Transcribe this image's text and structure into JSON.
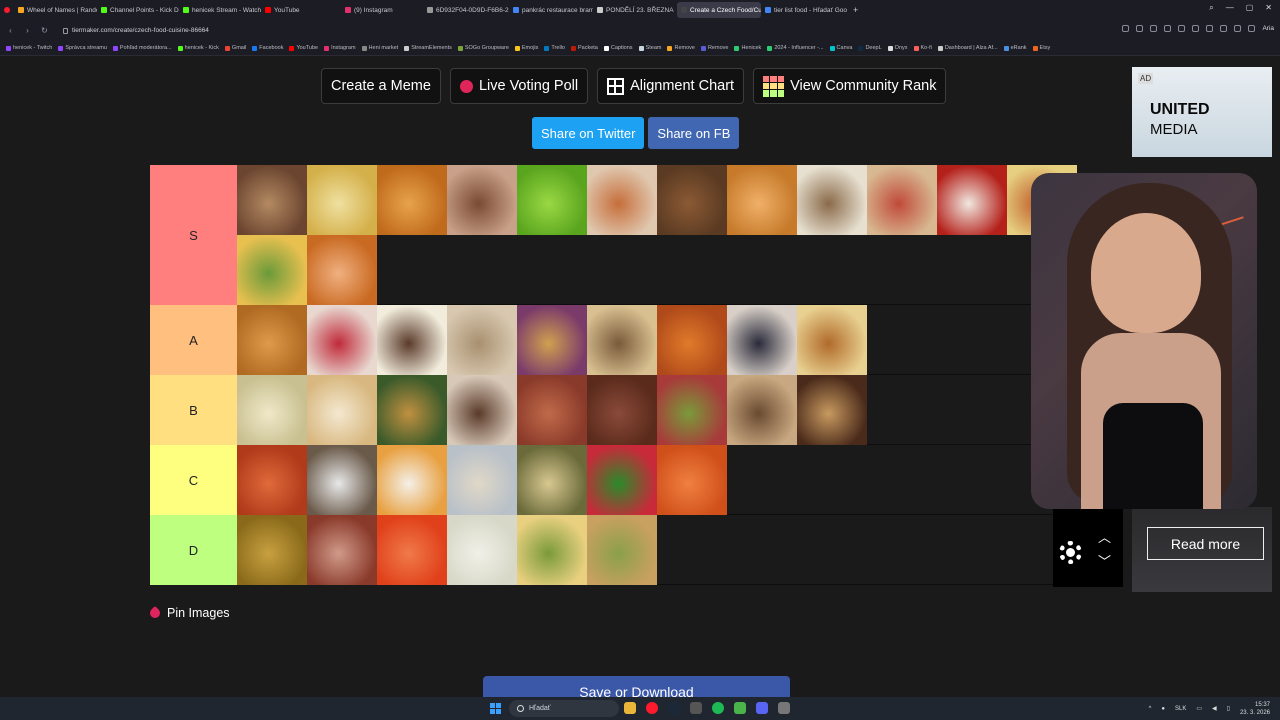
{
  "browser": {
    "tabs": [
      {
        "label": "Wheel of Names | Rando",
        "color": "#f5a623",
        "active": false
      },
      {
        "label": "Channel Points - Kick Dc",
        "color": "#53fc18",
        "active": false
      },
      {
        "label": "henicek Stream - Watch L",
        "color": "#53fc18",
        "active": false
      },
      {
        "label": "YouTube",
        "color": "#ff0000",
        "active": false
      },
      {
        "label": "(9) Instagram",
        "color": "#e1306c",
        "active": false
      },
      {
        "label": "6D932F04-0D9D-F6B6-2C",
        "color": "#999999",
        "active": false
      },
      {
        "label": "pankrác restaurace brambo",
        "color": "#4285f4",
        "active": false
      },
      {
        "label": "PONDĚLÍ 23. BŘEZNA",
        "color": "#cccccc",
        "active": false
      },
      {
        "label": "Create a Czech Food/Cuis",
        "color": "#444444",
        "active": true
      },
      {
        "label": "tier list food - Hľadať Goo",
        "color": "#4285f4",
        "active": false
      }
    ],
    "new_tab": "+",
    "url": "tiermaker.com/create/czech-food-cuisine-86664",
    "ai_label": "Aria",
    "bookmarks": [
      {
        "label": "henicek - Twitch",
        "color": "#9146ff"
      },
      {
        "label": "Správca streamu",
        "color": "#9146ff"
      },
      {
        "label": "Pohľad moderátora...",
        "color": "#9146ff"
      },
      {
        "label": "henicek - Kick",
        "color": "#53fc18"
      },
      {
        "label": "Gmail",
        "color": "#ea4335"
      },
      {
        "label": "Facebook",
        "color": "#1877f2"
      },
      {
        "label": "YouTube",
        "color": "#ff0000"
      },
      {
        "label": "Instagram",
        "color": "#e1306c"
      },
      {
        "label": "Heni market",
        "color": "#888888"
      },
      {
        "label": "StreamElements",
        "color": "#cccccc"
      },
      {
        "label": "SOGo Groupware",
        "color": "#7aa33a"
      },
      {
        "label": "Emojis",
        "color": "#f5c518"
      },
      {
        "label": "Trello",
        "color": "#0079bf"
      },
      {
        "label": "Packeta",
        "color": "#ba1b02"
      },
      {
        "label": "Captions",
        "color": "#ffffff"
      },
      {
        "label": "Steam",
        "color": "#c7d5e0"
      },
      {
        "label": "Remove",
        "color": "#f5a623"
      },
      {
        "label": "Remove",
        "color": "#5b5bd6"
      },
      {
        "label": "Henicek",
        "color": "#2ecc71"
      },
      {
        "label": "2024 - Influencer -...",
        "color": "#2ecc71"
      },
      {
        "label": "Canva",
        "color": "#00c4cc"
      },
      {
        "label": "DeepL",
        "color": "#0f2b46"
      },
      {
        "label": "Onyx",
        "color": "#dddddd"
      },
      {
        "label": "Ko-fi",
        "color": "#ff5e5b"
      },
      {
        "label": "Dashboard | Alza Af...",
        "color": "#cccccc"
      },
      {
        "label": "eRank",
        "color": "#4a90e2"
      },
      {
        "label": "Etsy",
        "color": "#f1641e"
      }
    ]
  },
  "toolbar": {
    "create_meme": "Create a Meme",
    "live_poll": "Live Voting Poll",
    "alignment_chart": "Alignment Chart",
    "community_rank": "View Community Rank",
    "share_twitter": "Share on Twitter",
    "share_fb": "Share on FB"
  },
  "tiers": [
    {
      "label": "S",
      "color": "#ff7f7f",
      "items": [
        [
          "#6b4530",
          "#b48a62"
        ],
        [
          "#d4b04a",
          "#efe0a0"
        ],
        [
          "#c06a1c",
          "#e7a34a"
        ],
        [
          "#c9a089",
          "#7a4a32"
        ],
        [
          "#5aa51e",
          "#9ad844"
        ],
        [
          "#e0c8b0",
          "#c66e3a"
        ],
        [
          "#5a3a22",
          "#8b5a34"
        ],
        [
          "#c67a2a",
          "#f0b068"
        ],
        [
          "#e7e0d0",
          "#8a6a4a"
        ],
        [
          "#d8b890",
          "#c04a3a"
        ],
        [
          "#b4201a",
          "#f0e8e0"
        ],
        [
          "#e6d080",
          "#c05a2a"
        ],
        [
          "#e8c050",
          "#6a9a3a"
        ],
        [
          "#c96a22",
          "#f0b080"
        ]
      ]
    },
    {
      "label": "A",
      "color": "#ffbf7f",
      "items": [
        [
          "#b06a22",
          "#e09a4a"
        ],
        [
          "#e8d8d0",
          "#c02a3a"
        ],
        [
          "#f2ecdc",
          "#5a3a2a"
        ],
        [
          "#d8c8b0",
          "#a89070"
        ],
        [
          "#7a3a6a",
          "#d0a050"
        ],
        [
          "#d8c090",
          "#7a5a3a"
        ],
        [
          "#b04a1a",
          "#e07a2a"
        ],
        [
          "#d8d0c8",
          "#2a2a3a"
        ],
        [
          "#e8d090",
          "#b06a2a"
        ]
      ]
    },
    {
      "label": "B",
      "color": "#ffdf7f",
      "items": [
        [
          "#c8c090",
          "#f0e8c8"
        ],
        [
          "#d8b880",
          "#f4e8d0"
        ],
        [
          "#3a5a2a",
          "#c09040"
        ],
        [
          "#d8c8b8",
          "#5a3a2a"
        ],
        [
          "#8a3a2a",
          "#c06a4a"
        ],
        [
          "#5a2a1a",
          "#8a4a3a"
        ],
        [
          "#a83a3a",
          "#7a9a3a"
        ],
        [
          "#c8a880",
          "#6a4a30"
        ],
        [
          "#4a2a1a",
          "#c89a60"
        ]
      ]
    },
    {
      "label": "C",
      "color": "#ffff7f",
      "items": [
        [
          "#b03a1a",
          "#e06a3a"
        ],
        [
          "#6a5a4a",
          "#e8e8e8"
        ],
        [
          "#e8a040",
          "#f4f0e8"
        ],
        [
          "#b8c0c8",
          "#e0d8c8"
        ],
        [
          "#6a6a3a",
          "#d8c890"
        ],
        [
          "#c82a3a",
          "#2a8a2a"
        ],
        [
          "#d0501a",
          "#f08040"
        ]
      ]
    },
    {
      "label": "D",
      "color": "#bfff7f",
      "items": [
        [
          "#8a6a1a",
          "#c8a040"
        ],
        [
          "#8a3a2a",
          "#d09a8a"
        ],
        [
          "#e0401a",
          "#f07a4a"
        ],
        [
          "#d8d8c8",
          "#f0f0e8"
        ],
        [
          "#e8d080",
          "#7a9a3a"
        ],
        [
          "#c8a060",
          "#8aa04a"
        ]
      ]
    }
  ],
  "pin_images": "Pin Images",
  "save_download": "Save or Download",
  "ad": {
    "badge": "AD",
    "title": "UNITED",
    "subtitle": "MEDIA",
    "read_more": "Read more"
  },
  "taskbar": {
    "search_placeholder": "Hľadať",
    "lang": "SLK",
    "time": "15:37",
    "date": "23. 3. 2026"
  }
}
